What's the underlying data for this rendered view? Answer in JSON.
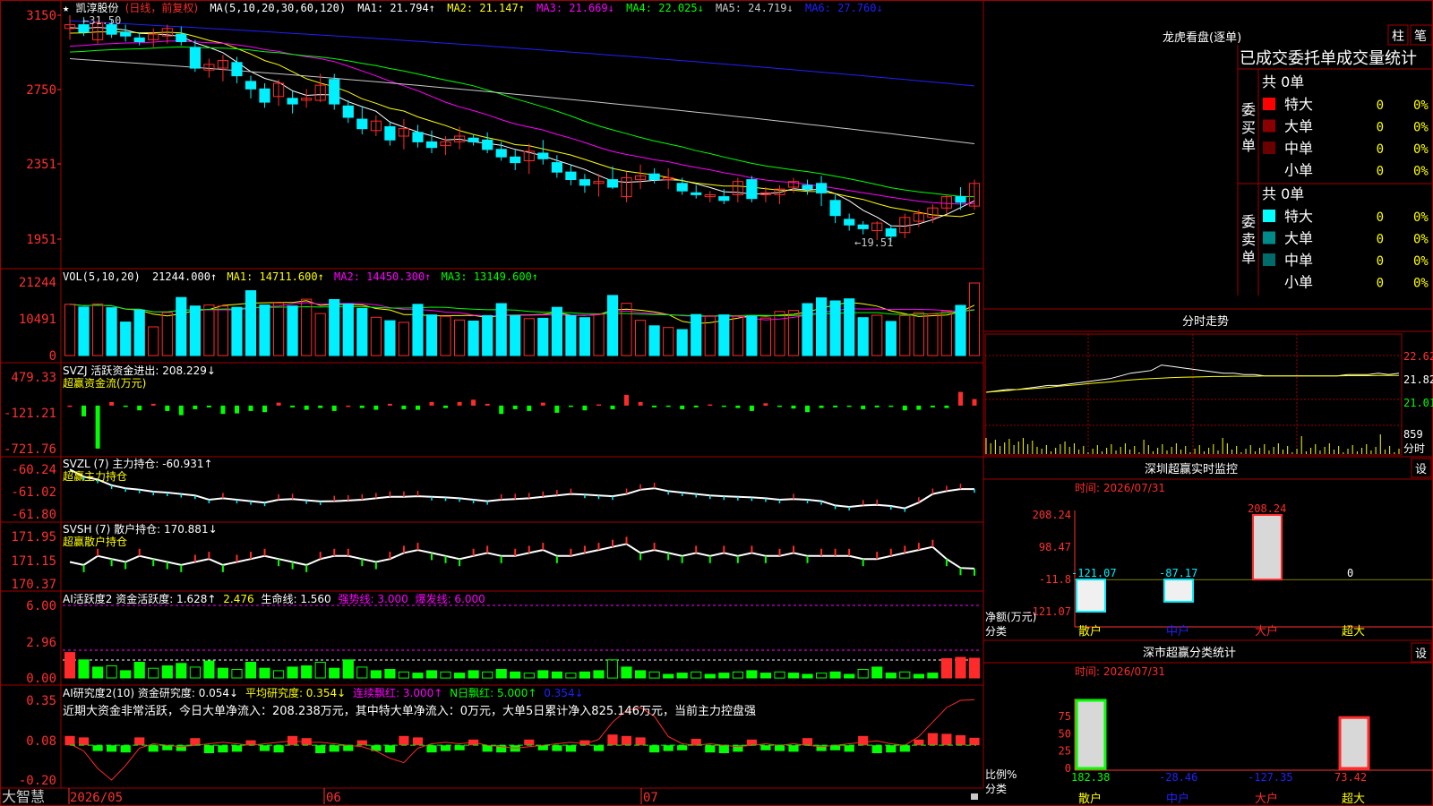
{
  "colors": {
    "up": "#ff2a2a",
    "down": "#00f0ff",
    "grid": "#a00000",
    "axis": "#ff3030",
    "yellow": "#ffff00",
    "magenta": "#ff00ff",
    "green": "#00ff00",
    "blue": "#2020ff",
    "gray": "#c8c8c8",
    "white": "#ffffff",
    "aqua_dark": "#008080",
    "dark_red": "#800000"
  },
  "main_panel": {
    "icon_star": "★",
    "stock_name": "凯淳股份",
    "period": "(日线，前复权)",
    "ma_title": "MA(5,10,20,30,60,120)",
    "ma_values": [
      {
        "label": "MA1: 21.794↑",
        "color": "#ffffff"
      },
      {
        "label": "MA2: 21.147↑",
        "color": "#ffff00"
      },
      {
        "label": "MA3: 21.669↓",
        "color": "#ff00ff"
      },
      {
        "label": "MA4: 22.025↓",
        "color": "#00ff00"
      },
      {
        "label": "MA5: 24.719↓",
        "color": "#c8c8c8"
      },
      {
        "label": "MA6: 27.760↓",
        "color": "#2020ff"
      }
    ],
    "y_ticks": [
      "3150",
      "2750",
      "2351",
      "1951"
    ],
    "high_marker": "←31.50",
    "low_marker": "←19.51"
  },
  "vol_panel": {
    "title": "VOL(5,10,20)",
    "value": "21244.000↑",
    "ma_values": [
      {
        "label": "MA1: 14711.600↑",
        "color": "#ffff00"
      },
      {
        "label": "MA2: 14450.300↑",
        "color": "#ff00ff"
      },
      {
        "label": "MA3: 13149.600↑",
        "color": "#00ff00"
      }
    ],
    "y_ticks": [
      "21244",
      "10491",
      "0"
    ]
  },
  "svzj_panel": {
    "title": "SVZJ  活跃资金进出: 208.229↓",
    "subtitle": "超赢资金流(万元)",
    "y_ticks": [
      "479.33",
      "-121.21",
      "-721.76"
    ]
  },
  "svzl_panel": {
    "title": "SVZL (7) 主力持仓: -60.931↑",
    "subtitle": "超赢主力持仓",
    "y_ticks": [
      "-60.24",
      "-61.02",
      "-61.80"
    ]
  },
  "svsh_panel": {
    "title": "SVSH (7) 散户持仓: 170.881↓",
    "subtitle": "超赢散户持仓",
    "y_ticks": [
      "171.95",
      "171.15",
      "170.37"
    ]
  },
  "ai1_panel": {
    "title": "AI活跃度2 资金活跃度: 1.628↑",
    "v2": "2.476",
    "v3": "生命线: 1.560",
    "v4": "强势线: 3.000",
    "v5": "爆发线: 6.000",
    "y_ticks": [
      "6.00",
      "2.96",
      "0.00"
    ]
  },
  "ai2_panel": {
    "title": "AI研究度2(10) 资金研究度: 0.054↓",
    "v2": "平均研究度: 0.354↓",
    "v3": "连续飘红: 3.000↑",
    "v4": "N日飘红: 5.000↑",
    "v5": "0.354↓",
    "note": "近期大资金非常活跃，今日大单净流入：208.238万元，其中特大单净流入：0万元，大单5日累计净入825.146万元，当前主力控盘强",
    "y_ticks": [
      "0.35",
      "0.08",
      "-0.20"
    ]
  },
  "bottom_bar": {
    "brand": "大智慧",
    "dates": [
      "2026/05",
      "06",
      "07"
    ]
  },
  "right_panel": {
    "top_title": "龙虎看盘(逐单)",
    "top_buttons": [
      "柱",
      "笔"
    ],
    "stats_title": "已成交委托单成交量统计",
    "buy_label": "委买单",
    "sell_label": "委卖单",
    "buy_total": "共 0单",
    "sell_total": "共 0单",
    "buy_rows": [
      {
        "name": "特大",
        "count": "0",
        "pct": "0%",
        "swatch": "#ff0000"
      },
      {
        "name": "大单",
        "count": "0",
        "pct": "0%",
        "swatch": "#8b0000"
      },
      {
        "name": "中单",
        "count": "0",
        "pct": "0%",
        "swatch": "#6b0000"
      },
      {
        "name": "小单",
        "count": "0",
        "pct": "0%",
        "swatch": ""
      }
    ],
    "sell_rows": [
      {
        "name": "特大",
        "count": "0",
        "pct": "0%",
        "swatch": "#00ffff"
      },
      {
        "name": "大单",
        "count": "0",
        "pct": "0%",
        "swatch": "#008b8b"
      },
      {
        "name": "中单",
        "count": "0",
        "pct": "0%",
        "swatch": "#006b6b"
      },
      {
        "name": "小单",
        "count": "0",
        "pct": "0%",
        "swatch": ""
      }
    ],
    "intraday_title": "分时走势",
    "intraday_ticks": [
      "22.62",
      "21.82",
      "21.01"
    ],
    "intraday_vol_top": "859",
    "intraday_vol_label": "分时",
    "monitor_title": "深圳超赢实时监控",
    "monitor_time": "时间: 2026/07/31",
    "monitor_button": "设",
    "monitor_y_ticks": [
      "208.24",
      "98.47",
      "-11.8",
      "-121.07"
    ],
    "monitor_y_label": "净额(万元)",
    "monitor_x_label": "分类",
    "monitor_values": [
      "-121.07",
      "-87.17",
      "208.24",
      "0"
    ],
    "categories": [
      "散户",
      "中户",
      "大户",
      "超大"
    ],
    "class_title": "深市超赢分类统计",
    "class_time": "时间: 2026/07/31",
    "class_button": "设",
    "class_y_ticks": [
      "75",
      "50",
      "25",
      "0"
    ],
    "class_y_label": "比例%",
    "class_x_label": "分类",
    "class_values": [
      "182.38",
      "-28.46",
      "-127.35",
      "73.42"
    ]
  },
  "chart_data": {
    "type": "candlestick",
    "ylim": [
      19.51,
      31.5
    ],
    "candles": [
      [
        30.8,
        31.5,
        30.2,
        31.0
      ],
      [
        31.0,
        31.4,
        30.4,
        30.6
      ],
      [
        30.2,
        31.2,
        30.0,
        31.1
      ],
      [
        31.0,
        31.3,
        30.3,
        30.5
      ],
      [
        30.6,
        31.0,
        30.1,
        30.4
      ],
      [
        30.3,
        30.6,
        29.9,
        30.1
      ],
      [
        30.2,
        30.8,
        29.8,
        30.5
      ],
      [
        30.4,
        31.0,
        30.0,
        30.8
      ],
      [
        30.5,
        30.9,
        29.9,
        30.1
      ],
      [
        29.8,
        30.2,
        28.5,
        28.7
      ],
      [
        28.6,
        29.2,
        28.2,
        28.9
      ],
      [
        28.7,
        29.4,
        28.0,
        29.1
      ],
      [
        29.0,
        29.3,
        27.9,
        28.3
      ],
      [
        28.0,
        28.3,
        27.1,
        27.6
      ],
      [
        27.6,
        27.9,
        26.6,
        26.9
      ],
      [
        27.2,
        28.1,
        26.7,
        27.9
      ],
      [
        27.1,
        27.5,
        26.3,
        26.8
      ],
      [
        27.0,
        27.6,
        26.6,
        27.1
      ],
      [
        27.0,
        28.4,
        26.9,
        27.8
      ],
      [
        28.1,
        28.4,
        26.5,
        26.8
      ],
      [
        26.7,
        27.0,
        25.8,
        26.1
      ],
      [
        26.0,
        26.7,
        25.2,
        25.5
      ],
      [
        25.4,
        26.2,
        25.1,
        25.9
      ],
      [
        25.6,
        25.9,
        24.6,
        24.9
      ],
      [
        25.1,
        26.0,
        24.4,
        25.5
      ],
      [
        25.3,
        25.7,
        24.5,
        24.8
      ],
      [
        24.8,
        25.4,
        24.2,
        24.5
      ],
      [
        24.6,
        25.1,
        24.1,
        24.8
      ],
      [
        24.8,
        25.6,
        24.4,
        25.1
      ],
      [
        25.0,
        25.2,
        24.6,
        24.8
      ],
      [
        24.9,
        25.3,
        24.2,
        24.4
      ],
      [
        24.4,
        24.8,
        23.8,
        24.0
      ],
      [
        24.0,
        24.4,
        23.3,
        23.7
      ],
      [
        23.8,
        24.7,
        23.1,
        24.3
      ],
      [
        24.2,
        24.9,
        23.6,
        23.9
      ],
      [
        23.7,
        24.1,
        22.9,
        23.2
      ],
      [
        23.2,
        23.6,
        22.5,
        22.8
      ],
      [
        22.8,
        23.1,
        22.1,
        22.5
      ],
      [
        22.6,
        23.1,
        21.9,
        22.7
      ],
      [
        22.8,
        23.5,
        22.3,
        22.4
      ],
      [
        21.9,
        23.2,
        21.6,
        22.9
      ],
      [
        22.8,
        23.6,
        22.3,
        23.0
      ],
      [
        23.1,
        23.4,
        22.6,
        22.8
      ],
      [
        22.8,
        23.4,
        22.3,
        22.9
      ],
      [
        22.6,
        22.9,
        22.0,
        22.2
      ],
      [
        22.1,
        22.5,
        21.8,
        22.0
      ],
      [
        21.9,
        22.2,
        21.6,
        22.0
      ],
      [
        21.9,
        22.3,
        21.5,
        21.7
      ],
      [
        22.0,
        22.9,
        21.6,
        22.7
      ],
      [
        22.8,
        23.0,
        21.6,
        21.8
      ],
      [
        22.0,
        22.4,
        21.6,
        22.1
      ],
      [
        22.0,
        22.5,
        21.5,
        22.3
      ],
      [
        22.4,
        22.9,
        22.1,
        22.7
      ],
      [
        22.5,
        22.8,
        22.0,
        22.3
      ],
      [
        22.6,
        23.0,
        21.4,
        22.1
      ],
      [
        21.7,
        22.0,
        20.5,
        20.9
      ],
      [
        20.7,
        21.0,
        20.1,
        20.4
      ],
      [
        20.4,
        20.6,
        19.9,
        20.2
      ],
      [
        20.1,
        20.6,
        19.6,
        20.5
      ],
      [
        20.2,
        20.4,
        19.51,
        19.8
      ],
      [
        20.0,
        21.0,
        19.7,
        20.8
      ],
      [
        20.6,
        21.2,
        20.3,
        21.0
      ],
      [
        20.8,
        21.5,
        20.5,
        21.3
      ],
      [
        21.3,
        22.0,
        21.0,
        21.9
      ],
      [
        21.9,
        22.4,
        21.2,
        21.6
      ],
      [
        21.4,
        22.8,
        21.2,
        22.6
      ]
    ],
    "volume": [
      15000,
      14200,
      15100,
      14000,
      9800,
      13300,
      8400,
      12600,
      17000,
      14500,
      14800,
      14500,
      14100,
      19000,
      14800,
      15400,
      14500,
      16500,
      12300,
      16400,
      15100,
      13800,
      11200,
      10200,
      9700,
      15000,
      11900,
      11500,
      10400,
      10100,
      11700,
      15200,
      11700,
      10800,
      10900,
      14100,
      11700,
      11100,
      12100,
      17600,
      15300,
      10300,
      8700,
      8200,
      7600,
      12000,
      11600,
      11900,
      11600,
      11600,
      11000,
      12900,
      13200,
      15200,
      16900,
      16000,
      16600,
      11100,
      11800,
      10000,
      11700,
      12600,
      12200,
      12900,
      14700,
      21244
    ],
    "svzj": [
      0,
      -180,
      -720,
      60,
      -20,
      -80,
      30,
      -90,
      -160,
      -60,
      -30,
      -140,
      -130,
      -90,
      -110,
      50,
      -30,
      -70,
      -40,
      -90,
      0,
      -40,
      -70,
      30,
      -60,
      -70,
      60,
      -40,
      60,
      100,
      30,
      -140,
      -60,
      -90,
      50,
      -120,
      -10,
      -80,
      20,
      -60,
      180,
      60,
      -30,
      -20,
      -60,
      -30,
      20,
      -10,
      -40,
      -90,
      40,
      -20,
      -50,
      -110,
      -40,
      -30,
      -10,
      -60,
      -30,
      -20,
      -80,
      -70,
      -30,
      -40,
      230,
      110
    ],
    "svzl": [
      -60.25,
      -60.5,
      -60.6,
      -60.8,
      -60.9,
      -60.95,
      -61.02,
      -61.05,
      -61.1,
      -61.15,
      -61.3,
      -61.25,
      -61.3,
      -61.35,
      -61.4,
      -61.3,
      -61.28,
      -61.32,
      -61.36,
      -61.35,
      -61.33,
      -61.3,
      -61.25,
      -61.2,
      -61.2,
      -61.18,
      -61.2,
      -61.22,
      -61.25,
      -61.3,
      -61.35,
      -61.3,
      -61.28,
      -61.25,
      -61.2,
      -61.15,
      -61.1,
      -61.12,
      -61.15,
      -61.18,
      -61.1,
      -60.95,
      -60.9,
      -61.0,
      -61.05,
      -61.1,
      -61.15,
      -61.18,
      -61.2,
      -61.22,
      -61.25,
      -61.3,
      -61.28,
      -61.3,
      -61.35,
      -61.5,
      -61.55,
      -61.5,
      -61.48,
      -61.52,
      -61.6,
      -61.4,
      -61.1,
      -61.0,
      -60.93,
      -60.931
    ],
    "svsh": [
      171.1,
      171.0,
      171.3,
      171.2,
      171.1,
      171.3,
      171.2,
      171.1,
      171.0,
      171.1,
      171.2,
      171.0,
      171.1,
      171.2,
      171.3,
      171.2,
      171.1,
      171.0,
      171.2,
      171.3,
      171.3,
      171.2,
      171.1,
      171.2,
      171.4,
      171.5,
      171.4,
      171.3,
      171.2,
      171.3,
      171.4,
      171.3,
      171.3,
      171.4,
      171.5,
      171.3,
      171.3,
      171.4,
      171.5,
      171.6,
      171.7,
      171.4,
      171.5,
      171.4,
      171.3,
      171.4,
      171.3,
      171.4,
      171.3,
      171.4,
      171.3,
      171.3,
      171.4,
      171.3,
      171.3,
      171.3,
      171.3,
      171.2,
      171.2,
      171.3,
      171.4,
      171.5,
      171.6,
      171.2,
      170.9,
      170.881
    ],
    "ai1": [
      2.1,
      1.5,
      0.9,
      1.0,
      0.6,
      1.3,
      0.8,
      1.0,
      1.2,
      0.9,
      1.4,
      0.8,
      0.7,
      1.3,
      0.8,
      0.6,
      0.9,
      1.0,
      1.3,
      0.8,
      1.5,
      0.9,
      0.6,
      0.7,
      0.5,
      0.4,
      0.6,
      0.5,
      0.4,
      0.6,
      0.5,
      0.7,
      0.5,
      0.4,
      0.6,
      0.5,
      0.4,
      0.5,
      0.6,
      1.5,
      0.9,
      0.6,
      0.5,
      0.3,
      0.4,
      0.5,
      0.3,
      0.4,
      0.5,
      0.6,
      0.4,
      0.5,
      0.4,
      0.3,
      0.4,
      0.5,
      0.3,
      0.7,
      0.9,
      0.4,
      0.5,
      0.3,
      0.4,
      1.6,
      1.7,
      1.628
    ],
    "ai2": [
      0.08,
      0.06,
      0.03,
      0.04,
      0.05,
      0.06,
      0.04,
      0.02,
      0.03,
      0.05,
      0.06,
      0.05,
      0.04,
      0.02,
      0.03,
      0.05,
      0.08,
      0.05,
      0.06,
      0.04,
      0.03,
      0.02,
      0.03,
      0.05,
      0.08,
      0.06,
      0.05,
      0.03,
      0.02,
      0.03,
      0.04,
      0.05,
      0.04,
      0.03,
      0.02,
      0.03,
      0.04,
      0.02,
      0.03,
      0.1,
      0.08,
      0.06,
      0.05,
      0.03,
      0.02,
      0.04,
      0.05,
      0.06,
      0.04,
      0.03,
      0.02,
      0.03,
      0.04,
      0.05,
      0.03,
      0.02,
      0.04,
      0.08,
      0.06,
      0.05,
      0.04,
      0.03,
      0.12,
      0.11,
      0.09,
      0.054
    ],
    "ai2_avg": [
      0.05,
      0.0,
      -0.12,
      -0.2,
      -0.1,
      0.02,
      0.05,
      0.04,
      0.03,
      0.04,
      0.05,
      0.06,
      0.05,
      0.04,
      0.05,
      0.06,
      0.07,
      0.06,
      0.06,
      0.05,
      0.04,
      0.03,
      0.0,
      -0.05,
      -0.08,
      0.02,
      0.05,
      0.06,
      0.05,
      0.06,
      0.04,
      0.03,
      0.02,
      0.03,
      0.04,
      0.05,
      0.06,
      0.05,
      0.08,
      0.2,
      0.28,
      0.3,
      0.24,
      0.1,
      0.05,
      0.04,
      0.05,
      0.04,
      0.03,
      0.04,
      0.05,
      0.04,
      0.05,
      0.04,
      0.03,
      0.04,
      0.05,
      0.06,
      0.07,
      0.05,
      0.04,
      0.1,
      0.2,
      0.3,
      0.35,
      0.354
    ],
    "intraday_price": [
      21.6,
      21.65,
      21.7,
      21.7,
      21.75,
      21.8,
      21.85,
      21.85,
      21.9,
      21.95,
      22.0,
      22.05,
      22.1,
      22.2,
      22.3,
      22.35,
      22.4,
      22.6,
      22.55,
      22.5,
      22.45,
      22.4,
      22.35,
      22.3,
      22.3,
      22.25,
      22.25,
      22.2,
      22.2,
      22.2,
      22.2,
      22.2,
      22.2,
      22.2,
      22.2,
      22.25,
      22.25,
      22.25,
      22.3,
      22.25,
      22.3
    ],
    "intraday_avg": [
      21.6,
      21.63,
      21.66,
      21.7,
      21.72,
      21.75,
      21.78,
      21.82,
      21.85,
      21.88,
      21.92,
      21.95,
      21.98,
      22.02,
      22.05,
      22.08,
      22.1,
      22.12,
      22.14,
      22.15,
      22.16,
      22.17,
      22.18,
      22.18,
      22.19,
      22.19,
      22.19,
      22.2,
      22.2,
      22.2,
      22.2,
      22.2,
      22.2,
      22.2,
      22.2,
      22.21,
      22.21,
      22.21,
      22.22,
      22.22,
      22.22
    ],
    "monitor_net": [
      -121.07,
      -87.17,
      208.24,
      0
    ],
    "class_pct": [
      182.38,
      -28.46,
      -127.35,
      73.42
    ]
  }
}
